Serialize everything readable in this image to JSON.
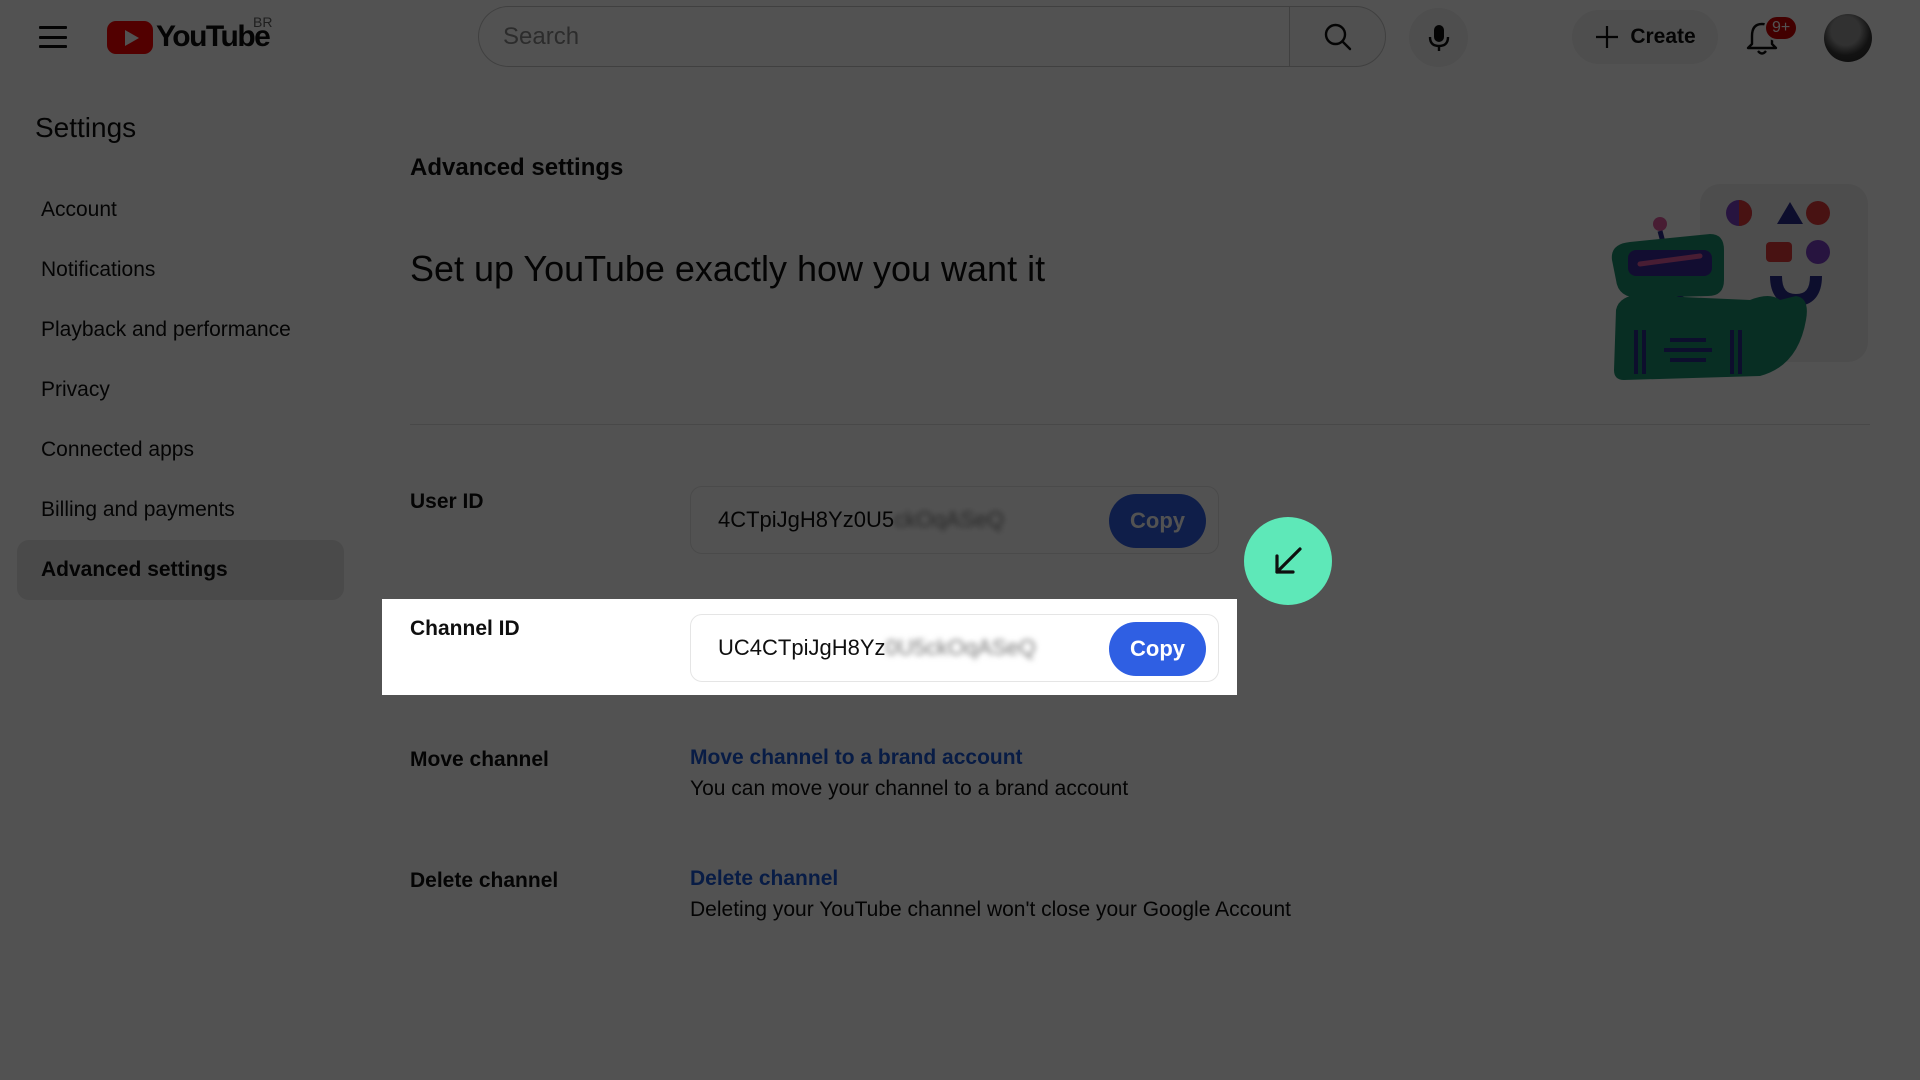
{
  "header": {
    "logo_text": "YouTube",
    "country_code": "BR",
    "search_placeholder": "Search",
    "create_label": "Create",
    "notification_count": "9+"
  },
  "sidebar": {
    "title": "Settings",
    "items": [
      {
        "label": "Account"
      },
      {
        "label": "Notifications"
      },
      {
        "label": "Playback and performance"
      },
      {
        "label": "Privacy"
      },
      {
        "label": "Connected apps"
      },
      {
        "label": "Billing and payments"
      },
      {
        "label": "Advanced settings",
        "active": true
      }
    ]
  },
  "main": {
    "section_label": "Advanced settings",
    "headline": "Set up YouTube exactly how you want it",
    "user_id": {
      "label": "User ID",
      "value_visible": "4CTpiJgH8Yz0U5",
      "value_blurred": "ckOqASeQ",
      "copy_label": "Copy"
    },
    "channel_id": {
      "label": "Channel ID",
      "value_visible": "UC4CTpiJgH8Yz",
      "value_blurred": "0U5ckOqASeQ",
      "copy_label": "Copy"
    },
    "move_channel": {
      "label": "Move channel",
      "link": "Move channel to a brand account",
      "description": "You can move your channel to a brand account"
    },
    "delete_channel": {
      "label": "Delete channel",
      "link": "Delete channel",
      "description": "Deleting your YouTube channel won't close your Google Account"
    }
  },
  "colors": {
    "accent_blue": "#2f5fe3",
    "link_blue": "#1a57d6",
    "pointer_green": "#5ee8b8",
    "brand_red": "#ff0000"
  },
  "icons": [
    "menu-icon",
    "youtube-logo",
    "search-icon",
    "mic-icon",
    "plus-icon",
    "bell-icon",
    "avatar",
    "arrow-down-left-icon"
  ]
}
